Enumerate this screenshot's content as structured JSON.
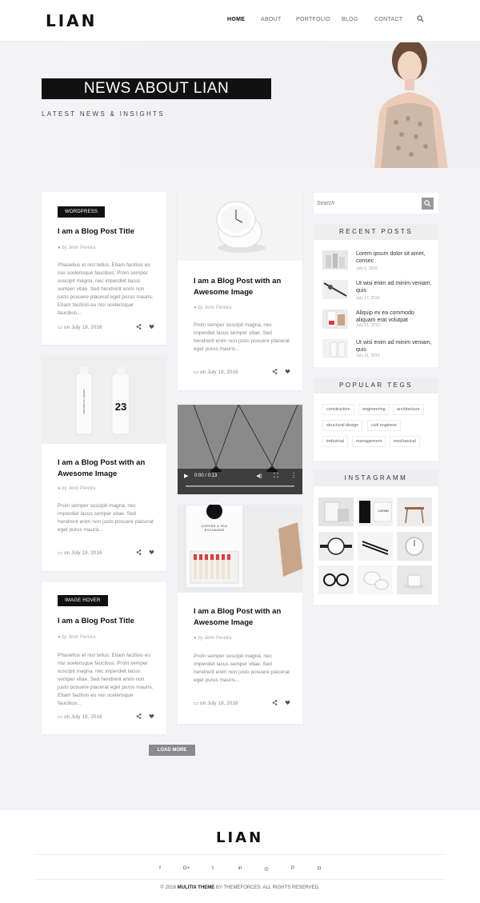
{
  "header": {
    "logo": "LIAN",
    "nav": [
      "HOME",
      "ABOUT",
      "PORTFOLIO",
      "BLOG",
      "CONTACT"
    ]
  },
  "hero": {
    "title": "NEWS ABOUT LIAN",
    "subtitle": "LATEST NEWS & INSIGHTS"
  },
  "posts": {
    "p1": {
      "badge": "WORDPRESS",
      "title": "I am a Blog Post Title",
      "author": "by Jenn Pereira",
      "excerpt": "Phasellus et nisl tellus. Etiam facilisis eu nisi scelerisque faucibus. Proin semper suscipit magna, nec imperdiet lacus semper vitae. Sed hendrerit enim non justo posuere placerat eget purus mauris. Etiam facilisis eu nisi scelerisque faucibus...",
      "date": "on July 19, 2016"
    },
    "p2": {
      "title": "I am a Blog Post with an Awesome Image",
      "author": "by Jenn Pereira",
      "excerpt": "Proin semper suscipit magna, nec imperdiet lacus semper vitae. Sed hendrerit enim non justo posuere placerat eget purus mauris...",
      "date": "on July 19, 2016"
    },
    "p3": {
      "title": "I am a Blog Post with an Awesome Image",
      "author": "by Jenn Pereira",
      "excerpt": "Proin semper suscipit magna, nec imperdiet lacus semper vitae. Sed hendrerit enim non justo posuere placerat eget purus mauris...",
      "date": "on July 19, 2016",
      "bottle_number": "23",
      "bottle_text": "SAPONETTE LIQUIDO"
    },
    "p4": {
      "time": "0:00 / 0:13"
    },
    "p5": {
      "title": "I am a Blog Post with an Awesome Image",
      "author": "by Jenn Pereira",
      "excerpt": "Proin semper suscipit magna, nec imperdiet lacus semper vitae. Sed hendrerit enim non justo posuere placerat eget purus mauris...",
      "date": "on July 19, 2016",
      "box_text": "COFFEE & TEA EXCHANGE"
    },
    "p6": {
      "badge": "IMAGE HOVER",
      "title": "I am a Blog Post Title",
      "author": "by Jenn Pereira",
      "excerpt": "Phasellus et nisl tellus. Etiam facilisis eu nisi scelerisque faucibus. Proin semper suscipit magna, nec imperdiet lacus semper vitae. Sed hendrerit enim non justo posuere placerat eget purus mauris. Etiam facilisis eu nisi scelerisque faucibus...",
      "date": "on July 19, 2016"
    }
  },
  "load_more": "LOAD MORE",
  "sidebar": {
    "search_placeholder": "Search",
    "recent_title": "RECENT POSTS",
    "recent": [
      {
        "title": "Lorem ipsum dolor sit amet, consec",
        "date": "July 5, 2016"
      },
      {
        "title": "Ut wisi enim ad minim veniam, quis",
        "date": "July 17, 2016"
      },
      {
        "title": "Aliquip ex ea commodo aliquam erat volutpat",
        "date": "July 21, 2016"
      },
      {
        "title": "Ut wisi enim ad minim veniam, quis",
        "date": "July 21, 2016"
      }
    ],
    "tags_title": "POPULAR TEGS",
    "tags": [
      "construction",
      "engineering",
      "architecture",
      "structural design",
      "civil engineer",
      "industrial",
      "management",
      "mechanical"
    ],
    "insta_title": "INSTAGRAMM",
    "insta_text": "CORINN"
  },
  "footer": {
    "logo": "LIAN",
    "social": [
      "f",
      "G+",
      "t",
      "in",
      "◎",
      "P",
      "◘"
    ],
    "copyright_prefix": "© 2016",
    "copyright_brand": "MULITIX THEME",
    "copyright_suffix": "BY THEMEFORCES. ALL RIGHTS RESERVED."
  }
}
